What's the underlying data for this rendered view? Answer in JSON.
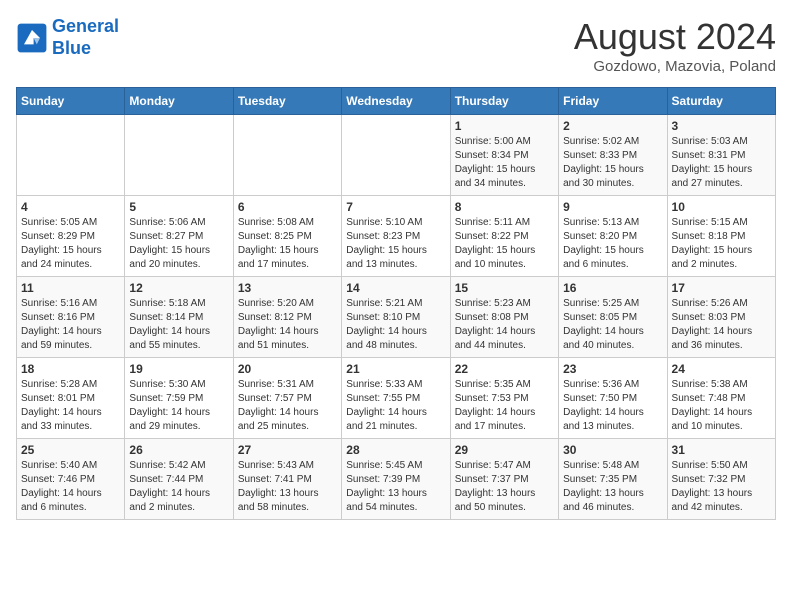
{
  "header": {
    "logo_line1": "General",
    "logo_line2": "Blue",
    "month_year": "August 2024",
    "location": "Gozdowo, Mazovia, Poland"
  },
  "weekdays": [
    "Sunday",
    "Monday",
    "Tuesday",
    "Wednesday",
    "Thursday",
    "Friday",
    "Saturday"
  ],
  "weeks": [
    [
      {
        "day": "",
        "sunrise": "",
        "sunset": "",
        "daylight": ""
      },
      {
        "day": "",
        "sunrise": "",
        "sunset": "",
        "daylight": ""
      },
      {
        "day": "",
        "sunrise": "",
        "sunset": "",
        "daylight": ""
      },
      {
        "day": "",
        "sunrise": "",
        "sunset": "",
        "daylight": ""
      },
      {
        "day": "1",
        "sunrise": "5:00 AM",
        "sunset": "8:34 PM",
        "daylight": "15 hours and 34 minutes."
      },
      {
        "day": "2",
        "sunrise": "5:02 AM",
        "sunset": "8:33 PM",
        "daylight": "15 hours and 30 minutes."
      },
      {
        "day": "3",
        "sunrise": "5:03 AM",
        "sunset": "8:31 PM",
        "daylight": "15 hours and 27 minutes."
      }
    ],
    [
      {
        "day": "4",
        "sunrise": "5:05 AM",
        "sunset": "8:29 PM",
        "daylight": "15 hours and 24 minutes."
      },
      {
        "day": "5",
        "sunrise": "5:06 AM",
        "sunset": "8:27 PM",
        "daylight": "15 hours and 20 minutes."
      },
      {
        "day": "6",
        "sunrise": "5:08 AM",
        "sunset": "8:25 PM",
        "daylight": "15 hours and 17 minutes."
      },
      {
        "day": "7",
        "sunrise": "5:10 AM",
        "sunset": "8:23 PM",
        "daylight": "15 hours and 13 minutes."
      },
      {
        "day": "8",
        "sunrise": "5:11 AM",
        "sunset": "8:22 PM",
        "daylight": "15 hours and 10 minutes."
      },
      {
        "day": "9",
        "sunrise": "5:13 AM",
        "sunset": "8:20 PM",
        "daylight": "15 hours and 6 minutes."
      },
      {
        "day": "10",
        "sunrise": "5:15 AM",
        "sunset": "8:18 PM",
        "daylight": "15 hours and 2 minutes."
      }
    ],
    [
      {
        "day": "11",
        "sunrise": "5:16 AM",
        "sunset": "8:16 PM",
        "daylight": "14 hours and 59 minutes."
      },
      {
        "day": "12",
        "sunrise": "5:18 AM",
        "sunset": "8:14 PM",
        "daylight": "14 hours and 55 minutes."
      },
      {
        "day": "13",
        "sunrise": "5:20 AM",
        "sunset": "8:12 PM",
        "daylight": "14 hours and 51 minutes."
      },
      {
        "day": "14",
        "sunrise": "5:21 AM",
        "sunset": "8:10 PM",
        "daylight": "14 hours and 48 minutes."
      },
      {
        "day": "15",
        "sunrise": "5:23 AM",
        "sunset": "8:08 PM",
        "daylight": "14 hours and 44 minutes."
      },
      {
        "day": "16",
        "sunrise": "5:25 AM",
        "sunset": "8:05 PM",
        "daylight": "14 hours and 40 minutes."
      },
      {
        "day": "17",
        "sunrise": "5:26 AM",
        "sunset": "8:03 PM",
        "daylight": "14 hours and 36 minutes."
      }
    ],
    [
      {
        "day": "18",
        "sunrise": "5:28 AM",
        "sunset": "8:01 PM",
        "daylight": "14 hours and 33 minutes."
      },
      {
        "day": "19",
        "sunrise": "5:30 AM",
        "sunset": "7:59 PM",
        "daylight": "14 hours and 29 minutes."
      },
      {
        "day": "20",
        "sunrise": "5:31 AM",
        "sunset": "7:57 PM",
        "daylight": "14 hours and 25 minutes."
      },
      {
        "day": "21",
        "sunrise": "5:33 AM",
        "sunset": "7:55 PM",
        "daylight": "14 hours and 21 minutes."
      },
      {
        "day": "22",
        "sunrise": "5:35 AM",
        "sunset": "7:53 PM",
        "daylight": "14 hours and 17 minutes."
      },
      {
        "day": "23",
        "sunrise": "5:36 AM",
        "sunset": "7:50 PM",
        "daylight": "14 hours and 13 minutes."
      },
      {
        "day": "24",
        "sunrise": "5:38 AM",
        "sunset": "7:48 PM",
        "daylight": "14 hours and 10 minutes."
      }
    ],
    [
      {
        "day": "25",
        "sunrise": "5:40 AM",
        "sunset": "7:46 PM",
        "daylight": "14 hours and 6 minutes."
      },
      {
        "day": "26",
        "sunrise": "5:42 AM",
        "sunset": "7:44 PM",
        "daylight": "14 hours and 2 minutes."
      },
      {
        "day": "27",
        "sunrise": "5:43 AM",
        "sunset": "7:41 PM",
        "daylight": "13 hours and 58 minutes."
      },
      {
        "day": "28",
        "sunrise": "5:45 AM",
        "sunset": "7:39 PM",
        "daylight": "13 hours and 54 minutes."
      },
      {
        "day": "29",
        "sunrise": "5:47 AM",
        "sunset": "7:37 PM",
        "daylight": "13 hours and 50 minutes."
      },
      {
        "day": "30",
        "sunrise": "5:48 AM",
        "sunset": "7:35 PM",
        "daylight": "13 hours and 46 minutes."
      },
      {
        "day": "31",
        "sunrise": "5:50 AM",
        "sunset": "7:32 PM",
        "daylight": "13 hours and 42 minutes."
      }
    ]
  ]
}
